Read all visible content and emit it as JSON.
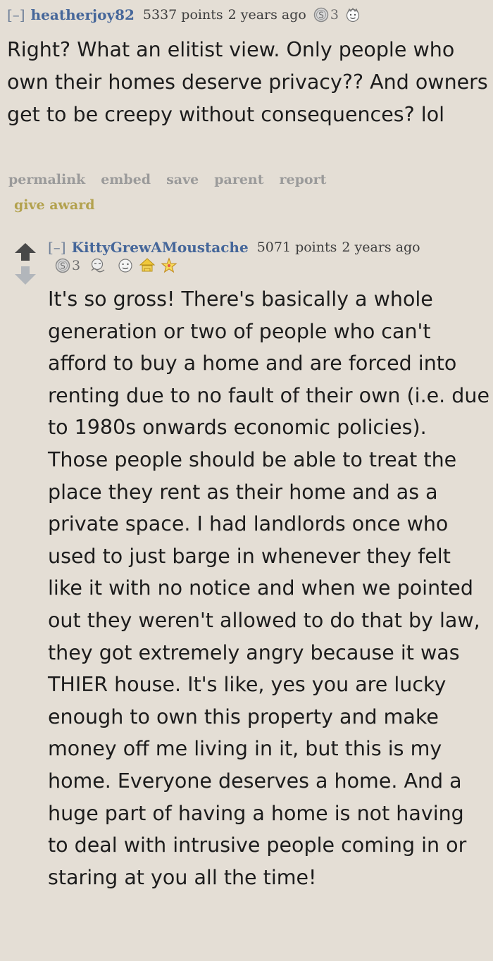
{
  "comments": [
    {
      "toggle": "[–]",
      "author": "heatherjoy82",
      "points": "5337 points",
      "age": "2 years ago",
      "gold_count": "3",
      "body": "Right? What an elitist view. Only people who own their homes deserve privacy?? And owners get to be creepy without consequences? lol",
      "actions": [
        "permalink",
        "embed",
        "save",
        "parent",
        "report"
      ],
      "give_award": "give award",
      "award_icons": [
        "silver-coin-icon",
        "wholesome-face-icon"
      ]
    },
    {
      "toggle": "[–]",
      "author": "KittyGrewAMoustache",
      "points": "5071 points",
      "age": "2 years ago",
      "gold_count": "3",
      "body": "It's so gross! There's basically a whole generation or two of people who can't afford to buy a home and are forced into renting due to no fault of their own (i.e. due to 1980s onwards economic policies). Those people should be able to treat the place they rent as their home and as a private space. I had landlords once who used to just barge in whenever they felt like it with no notice and when we pointed out they weren't allowed to do that by law, they got extremely angry because it was THIER house. It's like, yes you are lucky enough to own this property and make money off me living in it, but this is my home. Everyone deserves a home. And a huge part of having a home is not having to deal with intrusive people coming in or staring at you all the time!",
      "award_icons": [
        "silver-coin-icon",
        "thinking-face-icon",
        "wink-face-icon",
        "hat-award-icon",
        "star-award-icon"
      ]
    }
  ],
  "colors": {
    "background": "#e4ded5",
    "author": "#46679a",
    "action": "#9a9a9a",
    "give_award": "#b3a24f",
    "body_text": "#1c1c1c"
  }
}
